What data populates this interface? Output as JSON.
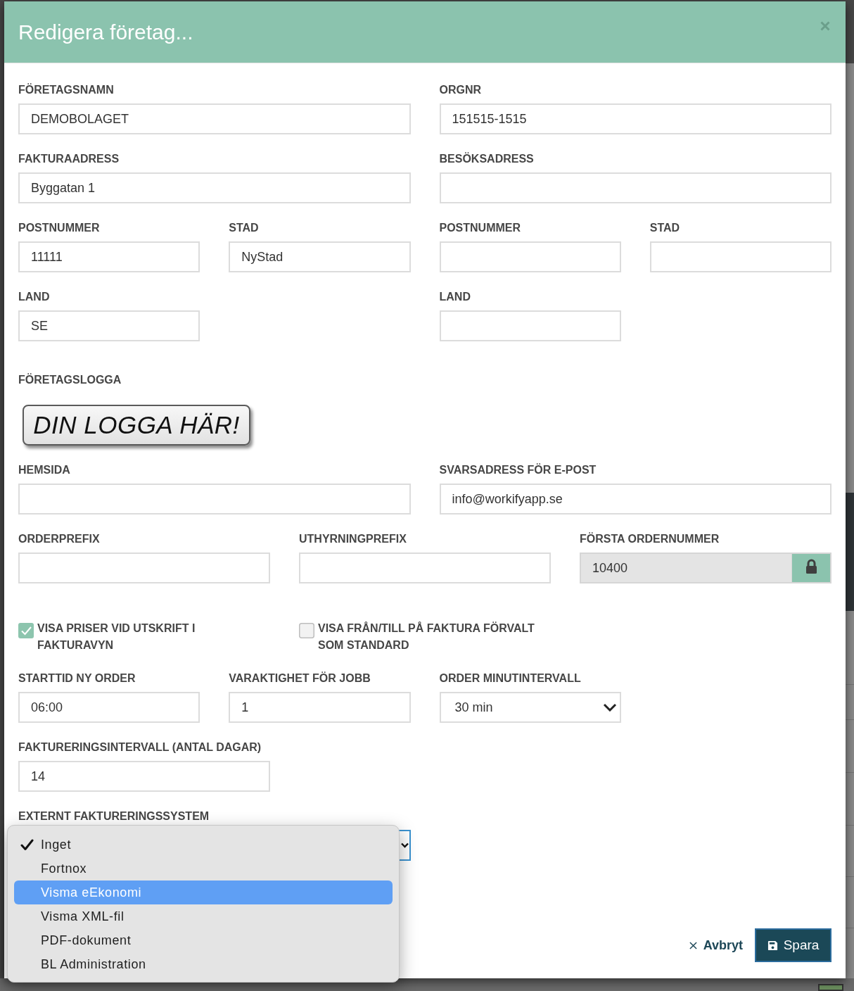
{
  "dialog": {
    "title": "Redigera företag..."
  },
  "fields": [
    {
      "kind": "text",
      "label": "FÖRETAGSNAMN",
      "value": "DEMOBOLAGET"
    },
    {
      "kind": "text",
      "label": "ORGNR",
      "value": "151515-1515"
    },
    {
      "kind": "text",
      "label": "FAKTURAADRESS",
      "value": "Byggatan 1"
    },
    {
      "kind": "text",
      "label": "BESÖKSADRESS"
    },
    {
      "kind": "text",
      "label": "POSTNUMMER",
      "value": "11111"
    },
    {
      "kind": "text",
      "label": "STAD",
      "value": "NyStad"
    },
    {
      "kind": "text",
      "label": "POSTNUMMER"
    },
    {
      "kind": "text",
      "label": "STAD"
    },
    {
      "kind": "text",
      "label": "LAND",
      "value": "SE"
    },
    {
      "kind": "text",
      "label": "LAND"
    },
    {
      "kind": "logo",
      "label": "FÖRETAGSLOGGA",
      "logo_text": "DIN LOGGA HÄR!"
    },
    {
      "kind": "text",
      "label": "HEMSIDA"
    },
    {
      "kind": "text",
      "label": "SVARSADRESS FÖR E-POST",
      "value": "info@workifyapp.se"
    },
    {
      "kind": "text",
      "label": "ORDERPREFIX"
    },
    {
      "kind": "text",
      "label": "UTHYRNINGPREFIX"
    },
    {
      "kind": "text",
      "label": "FÖRSTA ORDERNUMMER",
      "value": "10400",
      "locked": true
    },
    {
      "kind": "checkbox",
      "label": "VISA PRISER VID UTSKRIFT I FAKTURAVYN",
      "checked": true
    },
    {
      "kind": "checkbox",
      "label": "VISA FRÅN/TILL PÅ FAKTURA FÖRVALT SOM STANDARD",
      "checked": false
    },
    {
      "kind": "text",
      "label": "STARTTID NY ORDER",
      "value": "06:00"
    },
    {
      "kind": "text",
      "label": "VARAKTIGHET FÖR JOBB",
      "value": "1"
    },
    {
      "kind": "select",
      "label": "ORDER MINUTINTERVALL",
      "value": "30 min"
    },
    {
      "kind": "text",
      "label": "FAKTURERINGSINTERVALL (ANTAL DAGAR)",
      "value": "14"
    },
    {
      "kind": "select",
      "label": "EXTERNT FAKTURERINGSSYSTEM",
      "open": true,
      "options": [
        {
          "label": "Inget",
          "selected": true,
          "highlighted": false
        },
        {
          "label": "Fortnox",
          "selected": false,
          "highlighted": false
        },
        {
          "label": "Visma eEkonomi",
          "selected": false,
          "highlighted": true
        },
        {
          "label": "Visma XML-fil",
          "selected": false,
          "highlighted": false
        },
        {
          "label": "PDF-dokument",
          "selected": false,
          "highlighted": false
        },
        {
          "label": "BL Administration",
          "selected": false,
          "highlighted": false
        }
      ]
    }
  ],
  "footer": {
    "cancel": "Avbryt",
    "save": "Spara"
  }
}
